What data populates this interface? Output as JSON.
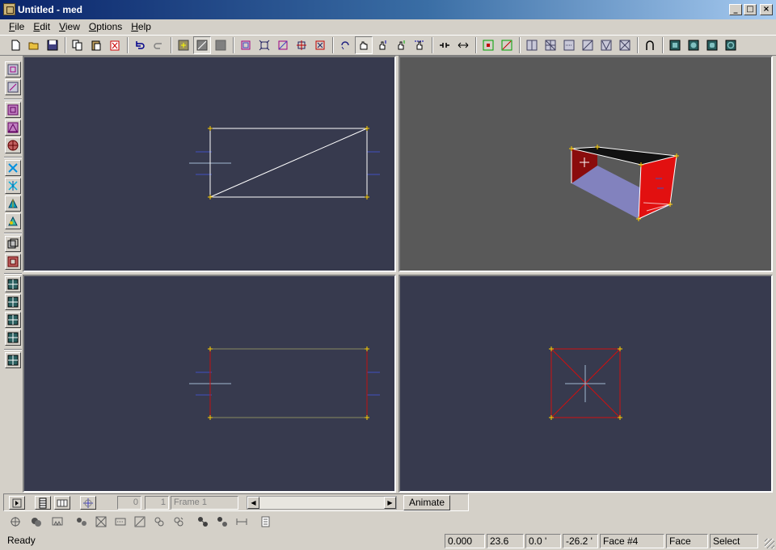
{
  "window": {
    "title": "Untitled - med"
  },
  "menu": [
    {
      "label": "File",
      "key": "F",
      "rest": "ile"
    },
    {
      "label": "Edit",
      "key": "E",
      "rest": "dit"
    },
    {
      "label": "View",
      "key": "V",
      "rest": "iew"
    },
    {
      "label": "Options",
      "key": "O",
      "rest": "ptions"
    },
    {
      "label": "Help",
      "key": "H",
      "rest": "elp"
    }
  ],
  "toolbar_icons": [
    "new-file-icon",
    "open-folder-icon",
    "save-icon",
    "copy-icon",
    "paste-icon",
    "delete-icon",
    "undo-icon",
    "redo-icon",
    "select-vertex-icon",
    "select-face-icon",
    "select-object-icon",
    "box-select-icon",
    "vertex-select-icon",
    "edge-select-icon",
    "grab-icon",
    "scale-icon",
    "rotate-icon",
    "hand-icon",
    "lift-icon",
    "lower-icon",
    "spread-icon",
    "snap-icon",
    "flip-icon",
    "add-vertex-icon",
    "add-face-icon",
    "mirror-icon",
    "grid-icon",
    "weld-icon",
    "split-icon",
    "triangle-icon",
    "cut-icon",
    "arch-icon",
    "cube-view-icon",
    "sphere-view-icon",
    "cylinder-view-icon",
    "disk-view-icon"
  ],
  "status": {
    "ready": "Ready",
    "coord_x": "0.000",
    "coord_y": "23.6",
    "coord_z": "0.0 '",
    "angle": "-26.2 '",
    "face": "Face #4",
    "mode": "Face",
    "tool": "Select"
  },
  "animation": {
    "frame_start": "0",
    "frame_count": "1",
    "frame_name": "Frame 1",
    "animate_label": "Animate"
  },
  "colors": {
    "viewport_bg": "#373a4e",
    "perspective_bg": "#595959",
    "edge": "#ffffff",
    "selected_face": "#e01010",
    "vertex": "#ffd000"
  }
}
